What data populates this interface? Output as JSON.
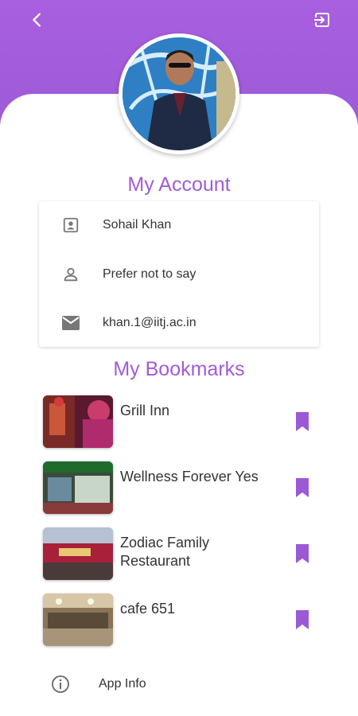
{
  "colors": {
    "accent": "#a35bd6",
    "header": "#9b59d6",
    "bookmark": "#9b59d6"
  },
  "header": {
    "back_icon": "back-arrow-icon",
    "logout_icon": "logout-icon"
  },
  "account": {
    "title": "My Account",
    "items": [
      {
        "icon": "contact-card-icon",
        "text": "Sohail Khan"
      },
      {
        "icon": "person-icon",
        "text": "Prefer not to say"
      },
      {
        "icon": "email-icon",
        "text": "khan.1@iitj.ac.in"
      }
    ]
  },
  "bookmarks": {
    "title": "My Bookmarks",
    "items": [
      {
        "name": "Grill Inn"
      },
      {
        "name": "Wellness Forever Yes"
      },
      {
        "name": "Zodiac Family Restaurant"
      },
      {
        "name": "cafe 651"
      }
    ]
  },
  "footer": {
    "app_info_label": "App Info",
    "icon": "info-icon"
  }
}
